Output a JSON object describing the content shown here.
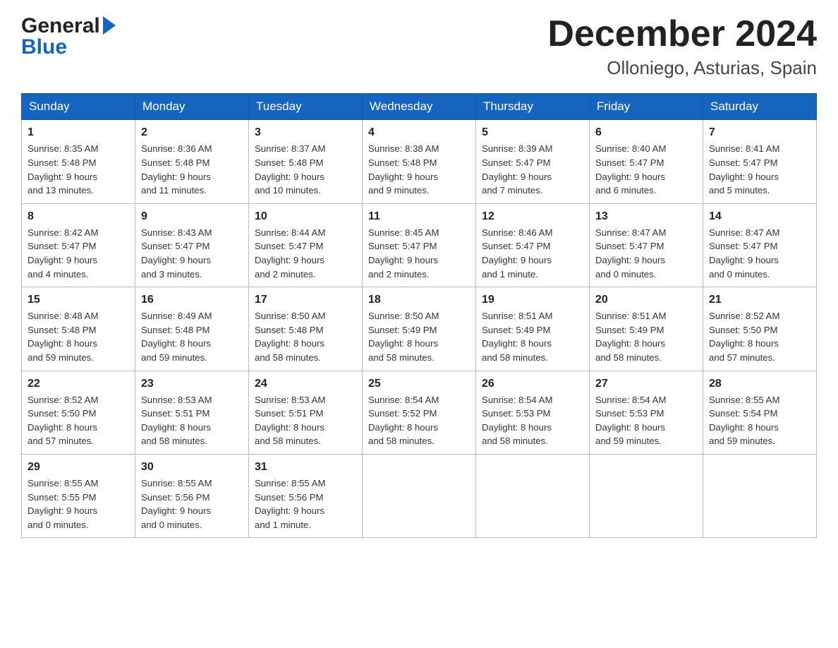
{
  "header": {
    "logo_general": "General",
    "logo_blue": "Blue",
    "month_title": "December 2024",
    "location": "Olloniego, Asturias, Spain"
  },
  "days_of_week": [
    "Sunday",
    "Monday",
    "Tuesday",
    "Wednesday",
    "Thursday",
    "Friday",
    "Saturday"
  ],
  "weeks": [
    [
      {
        "day": "1",
        "sunrise": "8:35 AM",
        "sunset": "5:48 PM",
        "daylight": "9 hours and 13 minutes."
      },
      {
        "day": "2",
        "sunrise": "8:36 AM",
        "sunset": "5:48 PM",
        "daylight": "9 hours and 11 minutes."
      },
      {
        "day": "3",
        "sunrise": "8:37 AM",
        "sunset": "5:48 PM",
        "daylight": "9 hours and 10 minutes."
      },
      {
        "day": "4",
        "sunrise": "8:38 AM",
        "sunset": "5:48 PM",
        "daylight": "9 hours and 9 minutes."
      },
      {
        "day": "5",
        "sunrise": "8:39 AM",
        "sunset": "5:47 PM",
        "daylight": "9 hours and 7 minutes."
      },
      {
        "day": "6",
        "sunrise": "8:40 AM",
        "sunset": "5:47 PM",
        "daylight": "9 hours and 6 minutes."
      },
      {
        "day": "7",
        "sunrise": "8:41 AM",
        "sunset": "5:47 PM",
        "daylight": "9 hours and 5 minutes."
      }
    ],
    [
      {
        "day": "8",
        "sunrise": "8:42 AM",
        "sunset": "5:47 PM",
        "daylight": "9 hours and 4 minutes."
      },
      {
        "day": "9",
        "sunrise": "8:43 AM",
        "sunset": "5:47 PM",
        "daylight": "9 hours and 3 minutes."
      },
      {
        "day": "10",
        "sunrise": "8:44 AM",
        "sunset": "5:47 PM",
        "daylight": "9 hours and 2 minutes."
      },
      {
        "day": "11",
        "sunrise": "8:45 AM",
        "sunset": "5:47 PM",
        "daylight": "9 hours and 2 minutes."
      },
      {
        "day": "12",
        "sunrise": "8:46 AM",
        "sunset": "5:47 PM",
        "daylight": "9 hours and 1 minute."
      },
      {
        "day": "13",
        "sunrise": "8:47 AM",
        "sunset": "5:47 PM",
        "daylight": "9 hours and 0 minutes."
      },
      {
        "day": "14",
        "sunrise": "8:47 AM",
        "sunset": "5:47 PM",
        "daylight": "9 hours and 0 minutes."
      }
    ],
    [
      {
        "day": "15",
        "sunrise": "8:48 AM",
        "sunset": "5:48 PM",
        "daylight": "8 hours and 59 minutes."
      },
      {
        "day": "16",
        "sunrise": "8:49 AM",
        "sunset": "5:48 PM",
        "daylight": "8 hours and 59 minutes."
      },
      {
        "day": "17",
        "sunrise": "8:50 AM",
        "sunset": "5:48 PM",
        "daylight": "8 hours and 58 minutes."
      },
      {
        "day": "18",
        "sunrise": "8:50 AM",
        "sunset": "5:49 PM",
        "daylight": "8 hours and 58 minutes."
      },
      {
        "day": "19",
        "sunrise": "8:51 AM",
        "sunset": "5:49 PM",
        "daylight": "8 hours and 58 minutes."
      },
      {
        "day": "20",
        "sunrise": "8:51 AM",
        "sunset": "5:49 PM",
        "daylight": "8 hours and 58 minutes."
      },
      {
        "day": "21",
        "sunrise": "8:52 AM",
        "sunset": "5:50 PM",
        "daylight": "8 hours and 57 minutes."
      }
    ],
    [
      {
        "day": "22",
        "sunrise": "8:52 AM",
        "sunset": "5:50 PM",
        "daylight": "8 hours and 57 minutes."
      },
      {
        "day": "23",
        "sunrise": "8:53 AM",
        "sunset": "5:51 PM",
        "daylight": "8 hours and 58 minutes."
      },
      {
        "day": "24",
        "sunrise": "8:53 AM",
        "sunset": "5:51 PM",
        "daylight": "8 hours and 58 minutes."
      },
      {
        "day": "25",
        "sunrise": "8:54 AM",
        "sunset": "5:52 PM",
        "daylight": "8 hours and 58 minutes."
      },
      {
        "day": "26",
        "sunrise": "8:54 AM",
        "sunset": "5:53 PM",
        "daylight": "8 hours and 58 minutes."
      },
      {
        "day": "27",
        "sunrise": "8:54 AM",
        "sunset": "5:53 PM",
        "daylight": "8 hours and 59 minutes."
      },
      {
        "day": "28",
        "sunrise": "8:55 AM",
        "sunset": "5:54 PM",
        "daylight": "8 hours and 59 minutes."
      }
    ],
    [
      {
        "day": "29",
        "sunrise": "8:55 AM",
        "sunset": "5:55 PM",
        "daylight": "9 hours and 0 minutes."
      },
      {
        "day": "30",
        "sunrise": "8:55 AM",
        "sunset": "5:56 PM",
        "daylight": "9 hours and 0 minutes."
      },
      {
        "day": "31",
        "sunrise": "8:55 AM",
        "sunset": "5:56 PM",
        "daylight": "9 hours and 1 minute."
      },
      null,
      null,
      null,
      null
    ]
  ],
  "labels": {
    "sunrise": "Sunrise:",
    "sunset": "Sunset:",
    "daylight": "Daylight:"
  }
}
